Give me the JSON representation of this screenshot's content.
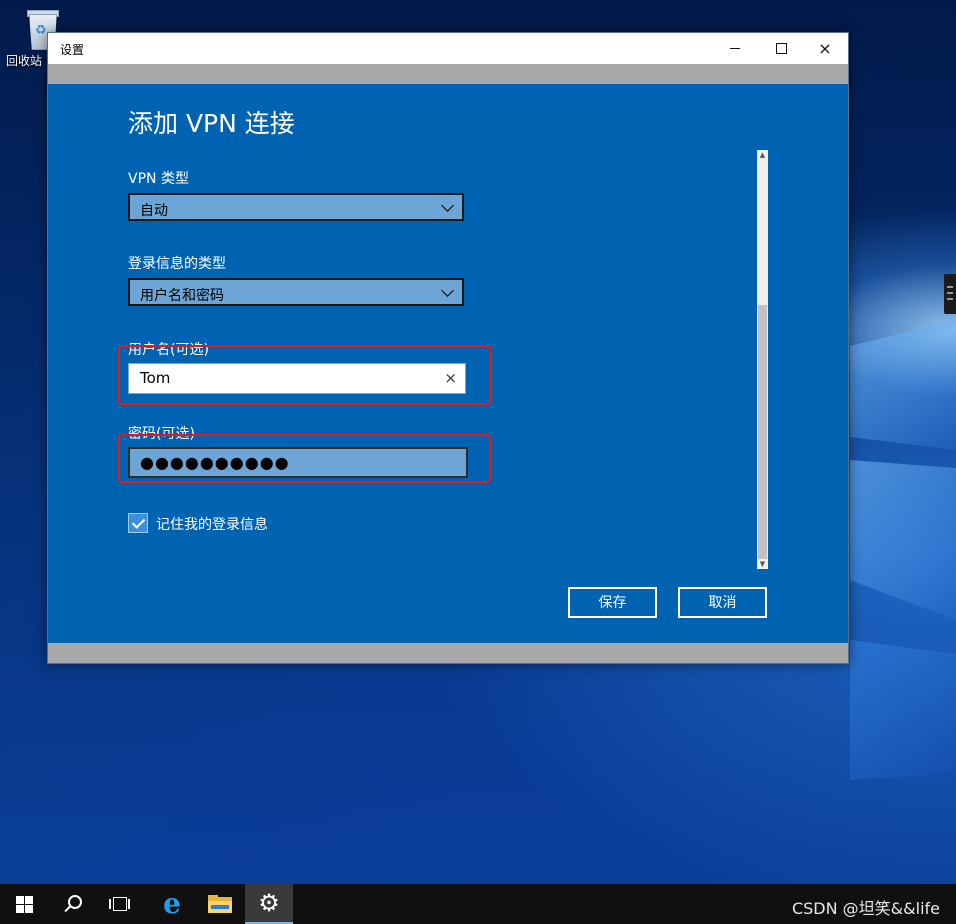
{
  "desktop": {
    "recycle_bin_label": "回收站"
  },
  "window": {
    "title": "设置",
    "controls": {
      "minimize": "minimize",
      "maximize": "maximize",
      "close": "×"
    }
  },
  "form": {
    "heading": "添加 VPN 连接",
    "vpn_type": {
      "label": "VPN 类型",
      "value": "自动"
    },
    "sign_in_type": {
      "label": "登录信息的类型",
      "value": "用户名和密码"
    },
    "username": {
      "label": "用户名(可选)",
      "value": "Tom",
      "clear_glyph": "×"
    },
    "password": {
      "label": "密码(可选)",
      "value": "●●●●●●●●●●"
    },
    "remember": {
      "label": "记住我的登录信息",
      "checked": true
    },
    "save_label": "保存",
    "cancel_label": "取消"
  },
  "scrollbar": {
    "up": "▲",
    "down": "▼"
  },
  "annotations": {
    "highlight_color": "#e01a1a"
  },
  "colors": {
    "panel": "#0063b1",
    "field": "#6da5d6"
  },
  "taskbar": {
    "items": [
      "start-icon",
      "search-icon",
      "task-view-icon",
      "ie-icon",
      "file-explorer-icon",
      "settings-icon"
    ],
    "ie_glyph": "e",
    "gear_glyph": "⚙",
    "watermark": "CSDN @坦笑&&life"
  }
}
